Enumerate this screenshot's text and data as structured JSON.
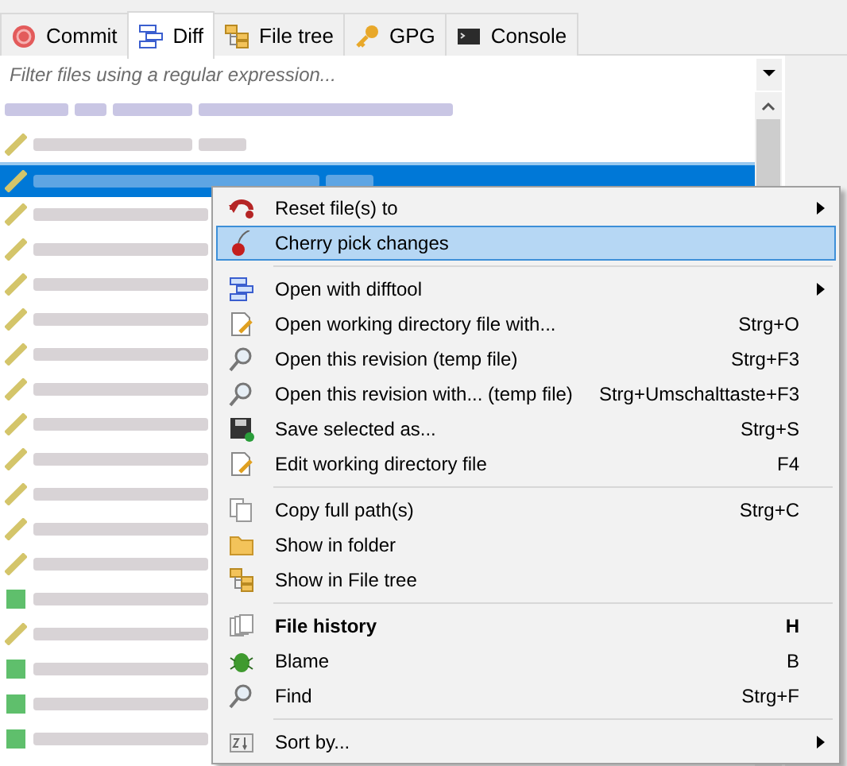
{
  "tabs": [
    {
      "label": "Commit",
      "selected": false
    },
    {
      "label": "Diff",
      "selected": true
    },
    {
      "label": "File tree",
      "selected": false
    },
    {
      "label": "GPG",
      "selected": false
    },
    {
      "label": "Console",
      "selected": false
    }
  ],
  "filter": {
    "placeholder": "Filter files using a regular expression..."
  },
  "files": [
    {
      "kind": "header",
      "selected": false
    },
    {
      "kind": "modified",
      "selected": false
    },
    {
      "kind": "modified",
      "selected": true
    },
    {
      "kind": "modified",
      "selected": false
    },
    {
      "kind": "modified",
      "selected": false
    },
    {
      "kind": "modified",
      "selected": false
    },
    {
      "kind": "modified",
      "selected": false
    },
    {
      "kind": "modified",
      "selected": false
    },
    {
      "kind": "modified",
      "selected": false
    },
    {
      "kind": "modified",
      "selected": false
    },
    {
      "kind": "modified",
      "selected": false
    },
    {
      "kind": "modified",
      "selected": false
    },
    {
      "kind": "modified",
      "selected": false
    },
    {
      "kind": "modified",
      "selected": false
    },
    {
      "kind": "added",
      "selected": false
    },
    {
      "kind": "modified",
      "selected": false
    },
    {
      "kind": "added",
      "selected": false
    },
    {
      "kind": "added",
      "selected": false
    },
    {
      "kind": "added",
      "selected": false
    }
  ],
  "context_menu": [
    {
      "kind": "item",
      "label": "Reset file(s) to",
      "submenu": true,
      "selected": false
    },
    {
      "kind": "item",
      "label": "Cherry pick changes",
      "selected": true
    },
    {
      "kind": "separator"
    },
    {
      "kind": "item",
      "label": "Open with difftool",
      "submenu": true,
      "selected": false
    },
    {
      "kind": "item",
      "label": "Open working directory file with...",
      "shortcut": "Strg+O",
      "selected": false
    },
    {
      "kind": "item",
      "label": "Open this revision (temp file)",
      "shortcut": "Strg+F3",
      "selected": false
    },
    {
      "kind": "item",
      "label": "Open this revision with... (temp file)",
      "shortcut": "Strg+Umschalttaste+F3",
      "selected": false
    },
    {
      "kind": "item",
      "label": "Save selected as...",
      "shortcut": "Strg+S",
      "selected": false
    },
    {
      "kind": "item",
      "label": "Edit working directory file",
      "shortcut": "F4",
      "selected": false
    },
    {
      "kind": "separator"
    },
    {
      "kind": "item",
      "label": "Copy full path(s)",
      "shortcut": "Strg+C",
      "selected": false
    },
    {
      "kind": "item",
      "label": "Show in folder",
      "selected": false
    },
    {
      "kind": "item",
      "label": "Show in File tree",
      "selected": false
    },
    {
      "kind": "separator"
    },
    {
      "kind": "item",
      "label": "File history",
      "shortcut": "H",
      "selected": false,
      "bold": true
    },
    {
      "kind": "item",
      "label": "Blame",
      "shortcut": "B",
      "selected": false
    },
    {
      "kind": "item",
      "label": "Find",
      "shortcut": "Strg+F",
      "selected": false
    },
    {
      "kind": "separator"
    },
    {
      "kind": "item",
      "label": "Sort by...",
      "submenu": true,
      "selected": false
    }
  ]
}
